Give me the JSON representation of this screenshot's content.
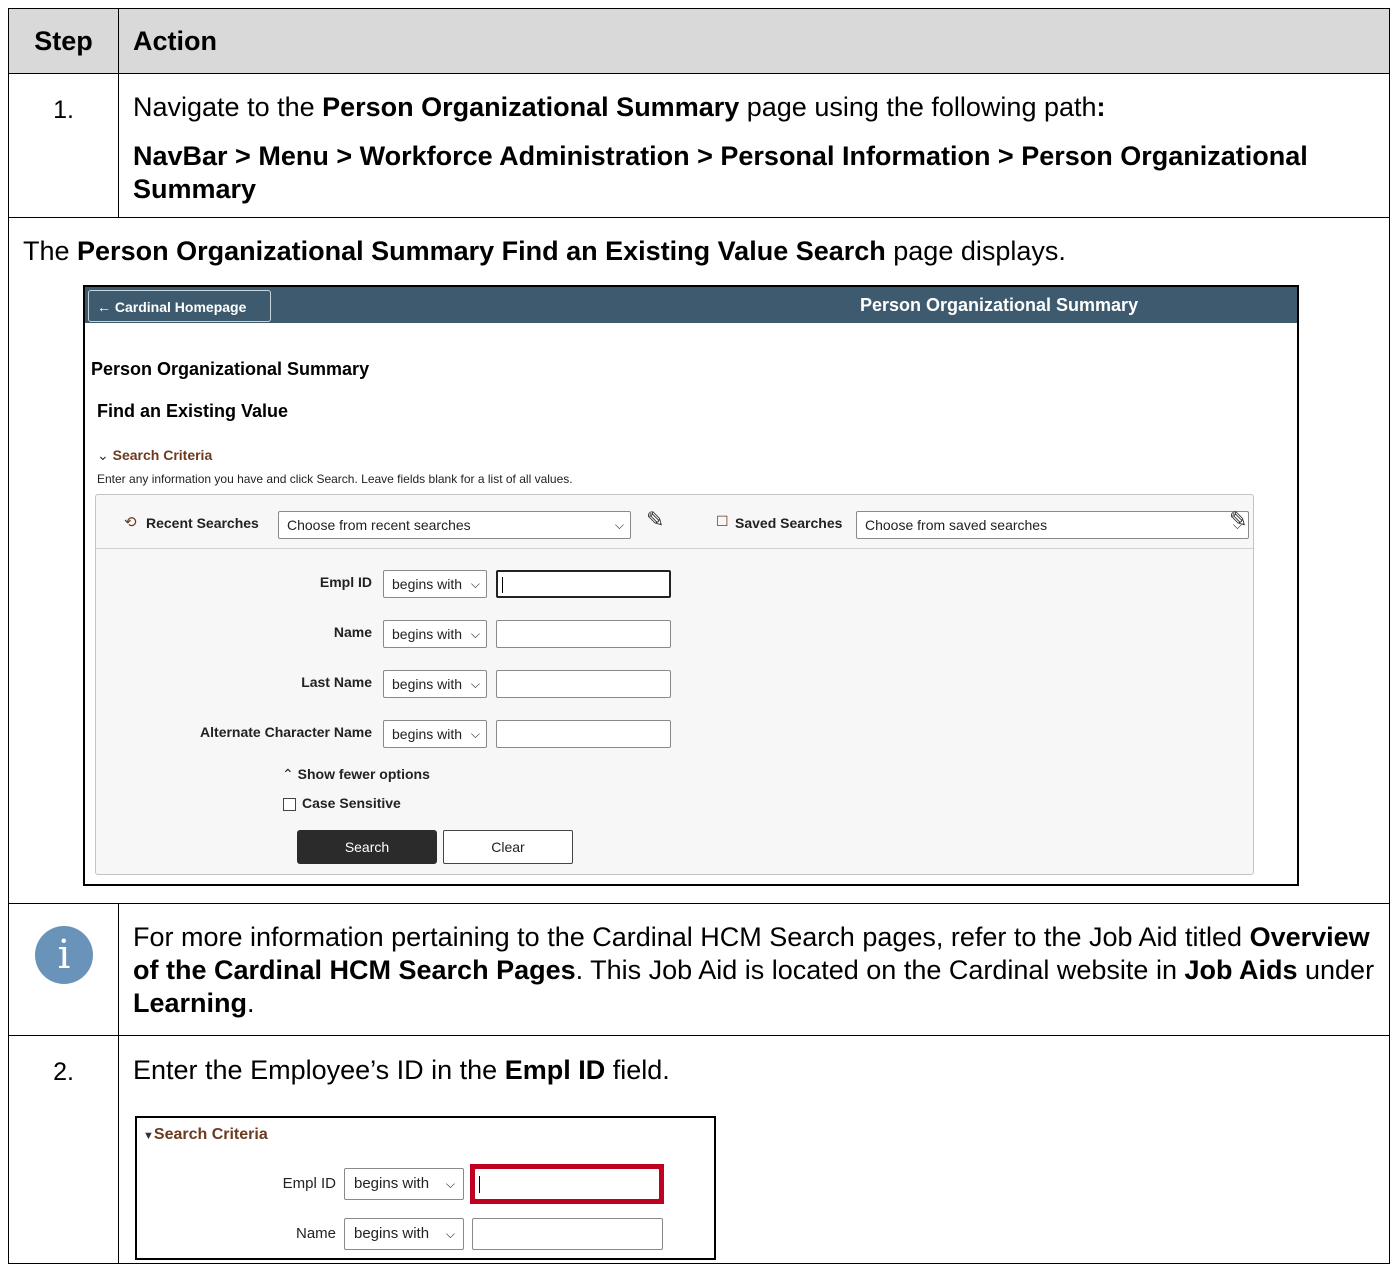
{
  "table": {
    "header": {
      "step": "Step",
      "action": "Action"
    },
    "step1": {
      "number": "1.",
      "text_a": "Navigate to the ",
      "text_bold": "Person Organizational Summary",
      "text_b": " page using the following path",
      "text_colon": ":",
      "path": "NavBar > Menu > Workforce Administration > Personal Information > Person Organizational Summary"
    },
    "caption": {
      "pre": "The ",
      "bold": "Person Organizational Summary Find an Existing Value Search",
      "post": " page displays."
    },
    "info": {
      "p1": "For more information pertaining to the Cardinal HCM Search pages, refer to the Job Aid titled ",
      "b1": "Overview of the Cardinal HCM Search Pages",
      "p2": ". This Job Aid is located on the Cardinal website in ",
      "b2": "Job Aids",
      "p3": " under ",
      "b3": "Learning",
      "p4": "."
    },
    "step2": {
      "number": "2.",
      "pre": "Enter the Employee’s ID in the ",
      "bold": "Empl ID",
      "post": " field."
    }
  },
  "screenshot1": {
    "back_button": "← Cardinal Homepage",
    "bar_title": "Person Organizational Summary",
    "page_title": "Person Organizational Summary",
    "subtitle": "Find an Existing Value",
    "criteria_toggle": "Search Criteria",
    "criteria_note": "Enter any information you have and click Search. Leave fields blank for a list of all values.",
    "recent_label": "Recent Searches",
    "recent_value": "Choose from recent searches",
    "saved_label": "Saved Searches",
    "saved_value": "Choose from saved searches",
    "fields": [
      {
        "label": "Empl ID",
        "operator": "begins with"
      },
      {
        "label": "Name",
        "operator": "begins with"
      },
      {
        "label": "Last Name",
        "operator": "begins with"
      },
      {
        "label": "Alternate Character Name",
        "operator": "begins with"
      }
    ],
    "show_fewer": "Show fewer options",
    "case_sensitive": "Case Sensitive",
    "search_button": "Search",
    "clear_button": "Clear"
  },
  "screenshot2": {
    "criteria_toggle": "Search Criteria",
    "fields": [
      {
        "label": "Empl ID",
        "operator": "begins with"
      },
      {
        "label": "Name",
        "operator": "begins with"
      }
    ],
    "highlight_color": "#c00020"
  },
  "colors": {
    "header_bg": "#d9d9d9",
    "navbar_bg": "#3e5a6e",
    "criteria_link": "#6b3a1f",
    "info_icon": "#6a93b9"
  }
}
